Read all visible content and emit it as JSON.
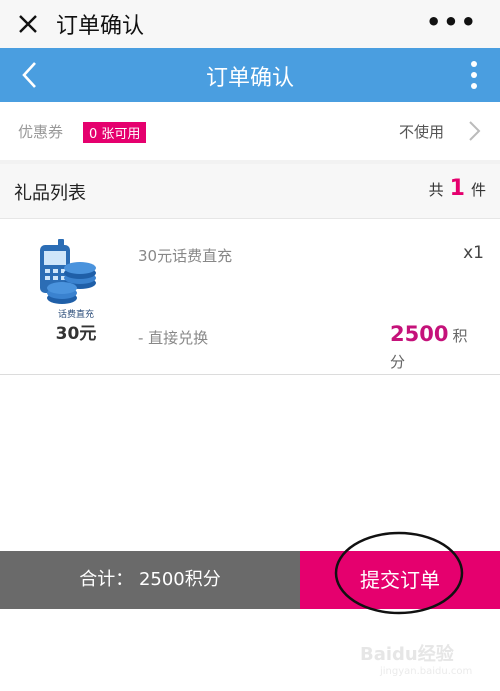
{
  "topbar": {
    "title": "订单确认"
  },
  "header": {
    "title": "订单确认"
  },
  "coupon": {
    "label": "优惠券",
    "available": "0 张可用",
    "value": "不使用"
  },
  "gift_list": {
    "title": "礼品列表",
    "count_prefix": "共",
    "count": "1",
    "count_suffix": "件",
    "items": [
      {
        "name": "30元话费直充",
        "quantity": "x1",
        "method": "- 直接兑换",
        "price": "2500",
        "price_unit": "积分",
        "image_caption": "话费直充",
        "image_amount": "30元"
      }
    ]
  },
  "bottom": {
    "total": "合计： 2500积分",
    "submit": "提交订单"
  },
  "watermark": {
    "text": "Baidu经验",
    "url": "jingyan.baidu.com"
  },
  "colors": {
    "header_blue": "#4a9ee0",
    "accent_pink": "#e5006e",
    "total_gray": "#6a6a6a"
  }
}
